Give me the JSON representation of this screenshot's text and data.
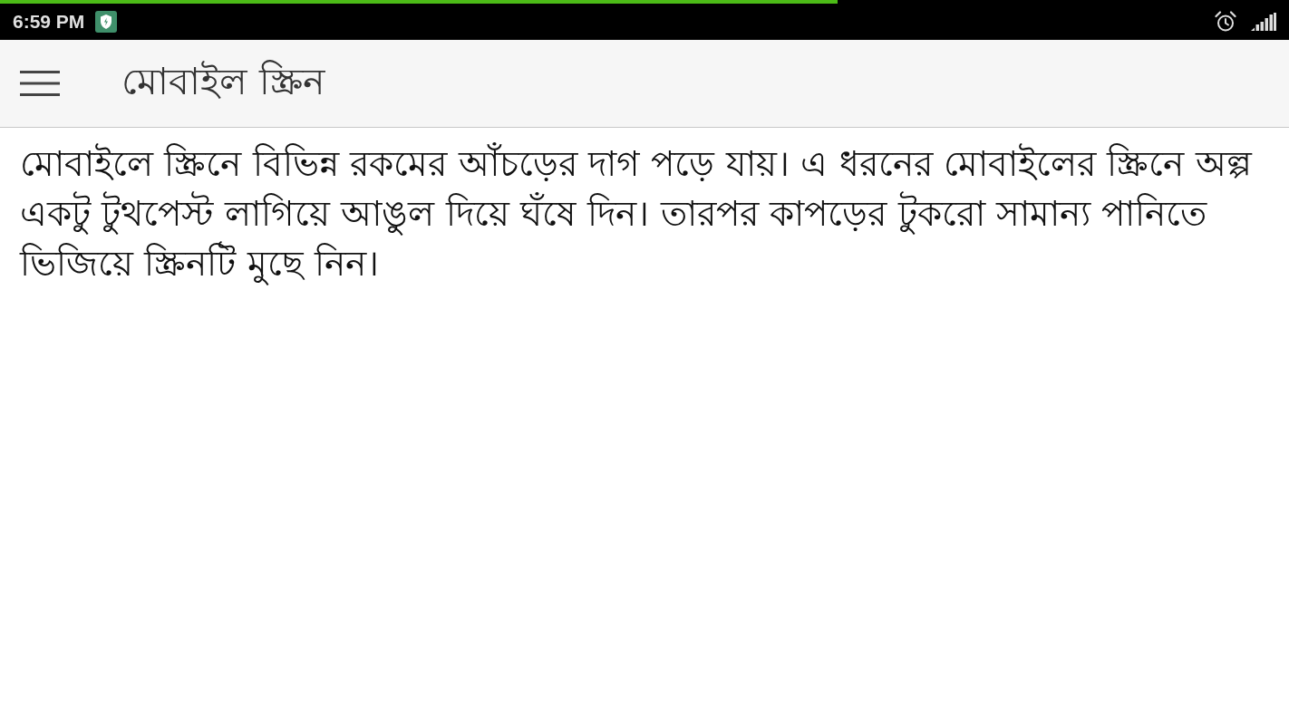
{
  "status_bar": {
    "time": "6:59 PM",
    "load_progress": {
      "level": 0.65
    }
  },
  "toolbar": {
    "title": "মোবাইল স্ক্রিন"
  },
  "article": {
    "text": "মোবাইলে স্ক্রিনে বিভিন্ন রকমের আঁচড়ের দাগ পড়ে যায়। এ ধরনের মোবাইলের স্ক্রিনে অল্প একটু টুথপেস্ট লাগিয়ে আঙুল দিয়ে ঘঁষে দিন। তারপর কাপড়ের টুকরো সামান্য পানিতে ভিজিয়ে স্ক্রিনটি মুছে নিন।"
  }
}
